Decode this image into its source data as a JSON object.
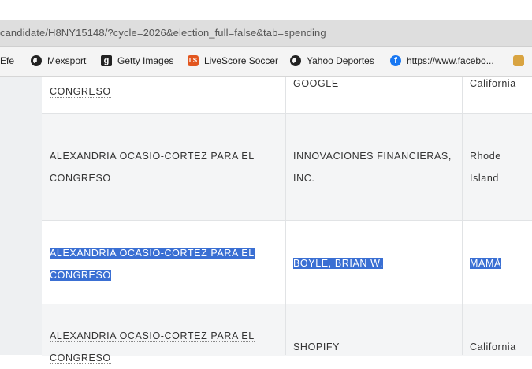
{
  "browser": {
    "url": "candidate/H8NY15148/?cycle=2026&election_full=false&tab=spending",
    "bookmarks": [
      {
        "label": "Efe",
        "icon": "none"
      },
      {
        "label": "Mexsport",
        "icon": "globe-icon"
      },
      {
        "label": "Getty Images",
        "icon": "getty-icon"
      },
      {
        "label": "LiveScore Soccer",
        "icon": "livescore-icon"
      },
      {
        "label": "Yahoo Deportes",
        "icon": "globe-icon"
      },
      {
        "label": "https://www.facebo...",
        "icon": "facebook-icon"
      }
    ]
  },
  "table": {
    "rows": [
      {
        "committee": [
          "CONGRESO"
        ],
        "recipient": [
          "GOOGLE"
        ],
        "state": [
          "California"
        ],
        "selected": false
      },
      {
        "committee": [
          "ALEXANDRIA OCASIO-CORTEZ PARA EL",
          "CONGRESO"
        ],
        "recipient": [
          "INNOVACIONES FINANCIERAS,",
          "INC."
        ],
        "state": [
          "Rhode",
          "Island"
        ],
        "selected": false
      },
      {
        "committee": [
          "ALEXANDRIA OCASIO-CORTEZ PARA EL",
          "CONGRESO"
        ],
        "recipient": [
          "BOYLE, BRIAN W."
        ],
        "state": [
          "MAMÁ"
        ],
        "selected": true
      },
      {
        "committee": [
          "ALEXANDRIA OCASIO-CORTEZ PARA EL",
          "CONGRESO"
        ],
        "recipient": [
          "SHOPIFY"
        ],
        "state": [
          "California"
        ],
        "selected": false
      }
    ]
  },
  "colors": {
    "selection": "#3a6fd3",
    "row_alt": "#f4f5f6",
    "sidebar": "#eef0f2"
  }
}
